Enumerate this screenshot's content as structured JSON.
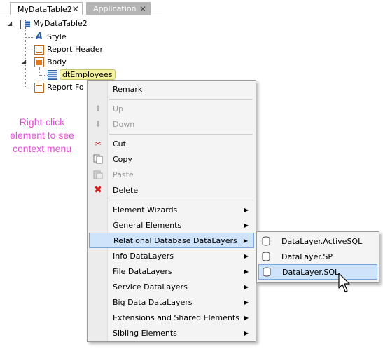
{
  "tabs": [
    {
      "label": "MyDataTable2",
      "active": true
    },
    {
      "label": "Application",
      "active": false
    }
  ],
  "tree": {
    "root": "MyDataTable2",
    "items": [
      {
        "label": "Style",
        "icon": "style-icon"
      },
      {
        "label": "Report Header",
        "icon": "report-header-icon"
      },
      {
        "label": "Body",
        "icon": "body-icon"
      },
      {
        "label": "dtEmployees",
        "icon": "data-table-icon"
      },
      {
        "label": "Report Fo",
        "icon": "report-footer-icon"
      }
    ]
  },
  "annotation": {
    "lines": [
      "Right-click",
      "element to see",
      "context menu"
    ],
    "color": "#e24fd8"
  },
  "context_menu": {
    "items": [
      {
        "label": "Remark",
        "enabled": true
      },
      {
        "label": "Up",
        "enabled": false,
        "icon": "up-arrow-icon"
      },
      {
        "label": "Down",
        "enabled": false,
        "icon": "down-arrow-icon"
      },
      {
        "label": "Cut",
        "enabled": true,
        "icon": "scissors-icon"
      },
      {
        "label": "Copy",
        "enabled": true,
        "icon": "copy-icon"
      },
      {
        "label": "Paste",
        "enabled": false,
        "icon": "paste-icon"
      },
      {
        "label": "Delete",
        "enabled": true,
        "icon": "delete-x-icon"
      },
      {
        "label": "Element Wizards",
        "submenu": true
      },
      {
        "label": "General Elements",
        "submenu": true
      },
      {
        "label": "Relational Database DataLayers",
        "submenu": true,
        "highlighted": true
      },
      {
        "label": "Info DataLayers",
        "submenu": true
      },
      {
        "label": "File DataLayers",
        "submenu": true
      },
      {
        "label": "Service DataLayers",
        "submenu": true
      },
      {
        "label": "Big Data DataLayers",
        "submenu": true
      },
      {
        "label": "Extensions and Shared Elements",
        "submenu": true
      },
      {
        "label": "Sibling Elements",
        "submenu": true
      }
    ]
  },
  "submenu": {
    "items": [
      {
        "label": "DataLayer.ActiveSQL"
      },
      {
        "label": "DataLayer.SP"
      },
      {
        "label": "DataLayer.SQL",
        "highlighted": true
      }
    ]
  },
  "colors": {
    "highlight": "#cfe3fa",
    "highlight_border": "#7aa6dc",
    "annotation": "#e24fd8"
  }
}
